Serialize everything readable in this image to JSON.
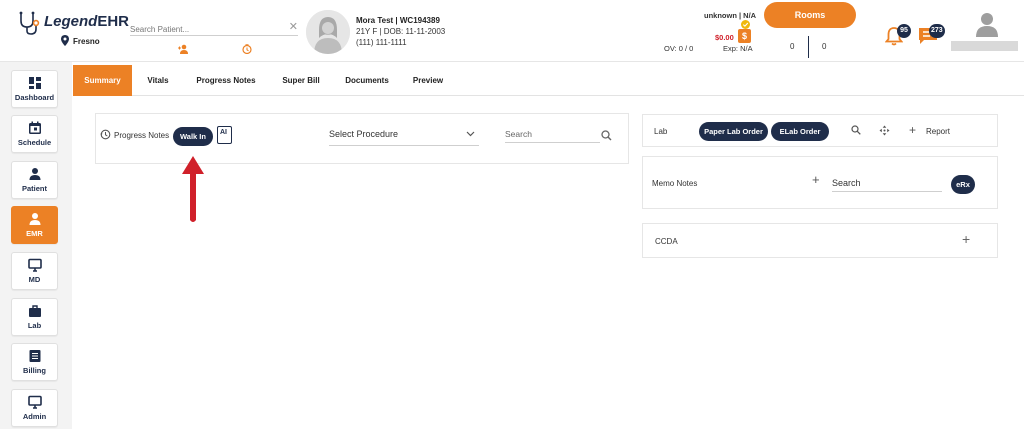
{
  "header": {
    "logo_italic": "Legend",
    "logo_bold": "EHR",
    "location": "Fresno",
    "search_placeholder": "Search Patient...",
    "patient": {
      "name_line": "Mora Test | WC194389",
      "demo_line": "21Y F | DOB: 11-11-2003",
      "phone_line": "(111) 111-1111"
    },
    "status_line": "unknown | N/A",
    "balance": "$0.00",
    "ov": "OV: 0 / 0",
    "exp": "Exp: N/A",
    "rooms_label": "Rooms",
    "room_count_left": "0",
    "room_count_right": "0",
    "notifications_count": "95",
    "messages_count": "273"
  },
  "sidebar": {
    "items": [
      {
        "label": "Dashboard"
      },
      {
        "label": "Schedule"
      },
      {
        "label": "Patient"
      },
      {
        "label": "EMR"
      },
      {
        "label": "MD"
      },
      {
        "label": "Lab"
      },
      {
        "label": "Billing"
      },
      {
        "label": "Admin"
      }
    ]
  },
  "tabs": [
    {
      "label": "Summary"
    },
    {
      "label": "Vitals"
    },
    {
      "label": "Progress Notes"
    },
    {
      "label": "Super Bill"
    },
    {
      "label": "Documents"
    },
    {
      "label": "Preview"
    }
  ],
  "progress": {
    "label": "Progress Notes",
    "walkin_label": "Walk In",
    "ai_label": "AI",
    "procedure_placeholder": "Select Procedure",
    "search_placeholder": "Search"
  },
  "lab": {
    "label": "Lab",
    "paper_order": "Paper Lab Order",
    "elab_order": "ELab Order",
    "report": "Report"
  },
  "memo": {
    "label": "Memo Notes",
    "search_placeholder": "Search",
    "erx": "eRx"
  },
  "ccda": {
    "label": "CCDA"
  },
  "colors": {
    "accent": "#ec8125",
    "navy": "#1f2d4a",
    "arrow": "#d0202a"
  }
}
